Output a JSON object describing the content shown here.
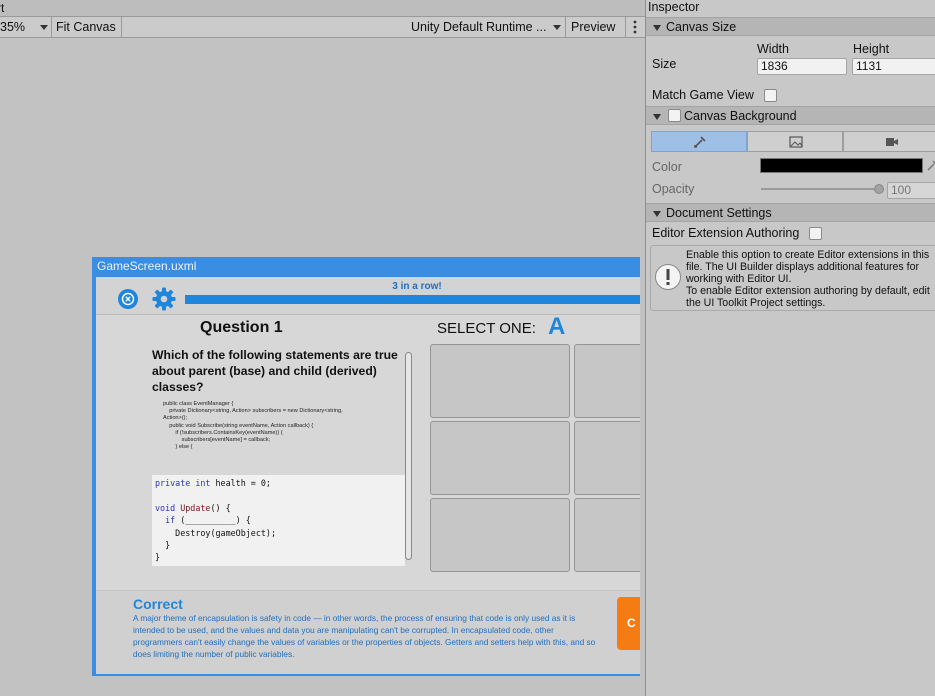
{
  "viewport": {
    "title_fragment": "rt",
    "toolbar": {
      "zoom": "35%",
      "fit_canvas": "Fit Canvas",
      "theme": "Unity Default Runtime ...",
      "preview": "Preview"
    }
  },
  "game": {
    "title": "GameScreen.uxml",
    "progress_label": "3 in a row!",
    "question_title": "Question 1",
    "select_label": "SELECT ONE:",
    "answer_letter": "A",
    "question_text": "Which of the following statements are true about parent (base) and child (derived) classes?",
    "code_small": [
      "public class EventManager {",
      "    private Dictionary<string, Action> subscribers = new Dictionary<string,",
      "Action>();",
      "",
      "    public void Subscribe(string eventName, Action callback) {",
      "        if (!subscribers.ContainsKey(eventName)) {",
      "            subscribers[eventName] = callback;",
      "        } else {"
    ],
    "code_big": {
      "line1_kw": "private int",
      "line1_rest": " health = 0;",
      "line2_kw": "void",
      "line2_fn": " Update",
      "line2_rest": "() {",
      "line3_kw": "  if",
      "line3_rest": " (__________) {",
      "line4": "    Destroy(gameObject);",
      "line5": "  }",
      "line6": "}"
    },
    "feedback": {
      "title": "Correct",
      "text": "A major theme of encapsulation is safety in code — in other words, the process of ensuring that code is only used as it is intended to be used, and the values and data you are manipulating can't be corrupted. In encapsulated code, other programmers can't easily change the values of variables or the properties of objects. Getters and setters help with this, and so does limiting the number of public variables.",
      "continue_label": "C"
    },
    "progress_value": 1.0
  },
  "inspector": {
    "title": "Inspector",
    "canvas_size": {
      "header": "Canvas Size",
      "width_label": "Width",
      "height_label": "Height",
      "size_label": "Size",
      "width_value": "1836",
      "height_value": "1131",
      "match_game_view": "Match Game View"
    },
    "canvas_background": {
      "header": "Canvas Background",
      "color_label": "Color",
      "opacity_label": "Opacity",
      "opacity_value": "100",
      "color_value": "#000000"
    },
    "document_settings": {
      "header": "Document Settings",
      "editor_extension": "Editor Extension Authoring",
      "help_text": "Enable this option to create Editor extensions in this file. The UI Builder displays additional features for working with Editor UI.\nTo enable Editor extension authoring by default, edit the UI Toolkit Project settings."
    }
  },
  "colors": {
    "accent_blue": "#1f86dd",
    "game_frame": "#3a8de0",
    "continue_orange": "#f57c12"
  }
}
